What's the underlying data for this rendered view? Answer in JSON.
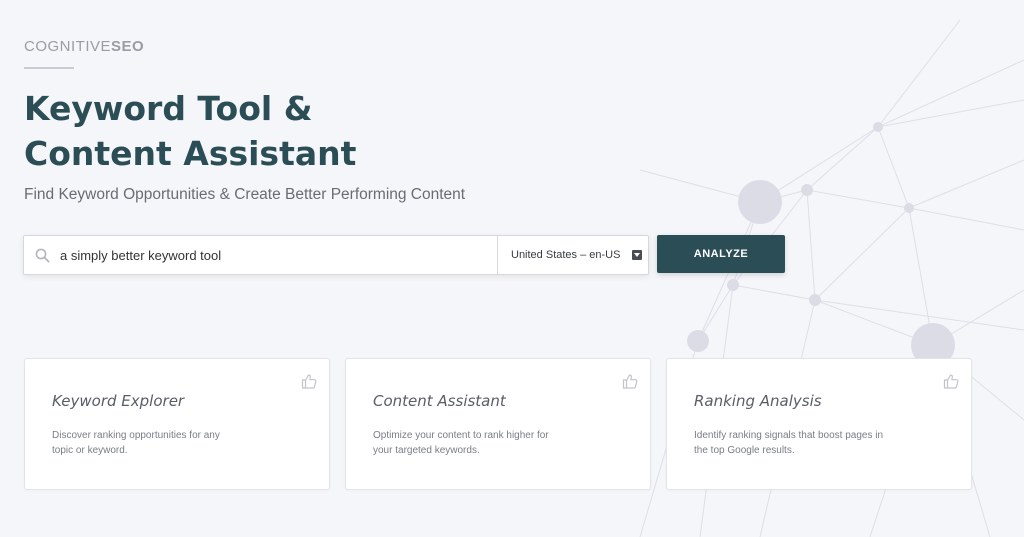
{
  "brand": {
    "logo_prefix": "COGNITIVE",
    "logo_suffix": "SEO"
  },
  "hero": {
    "title_line1": "Keyword Tool &",
    "title_line2": "Content Assistant",
    "subtitle": "Find Keyword Opportunities & Create Better Performing Content"
  },
  "search": {
    "icon": "search-icon",
    "value": "a simply better keyword tool",
    "locale": "United States – en-US",
    "locale_icon": "dropdown-caret-icon",
    "button_label": "ANALYZE"
  },
  "cards": [
    {
      "title": "Keyword Explorer",
      "description": "Discover ranking opportunities for any topic or keyword.",
      "icon": "thumbs-up-icon"
    },
    {
      "title": "Content Assistant",
      "description": "Optimize your content to rank higher for your targeted keywords.",
      "icon": "thumbs-up-icon"
    },
    {
      "title": "Ranking Analysis",
      "description": "Identify ranking signals that boost pages in the top Google results.",
      "icon": "thumbs-up-icon"
    }
  ],
  "colors": {
    "background": "#f5f6f9",
    "brand_dark_teal": "#2b4d56",
    "logo_gray": "#9a9ca6",
    "network_nodes": "#dcdce6"
  }
}
